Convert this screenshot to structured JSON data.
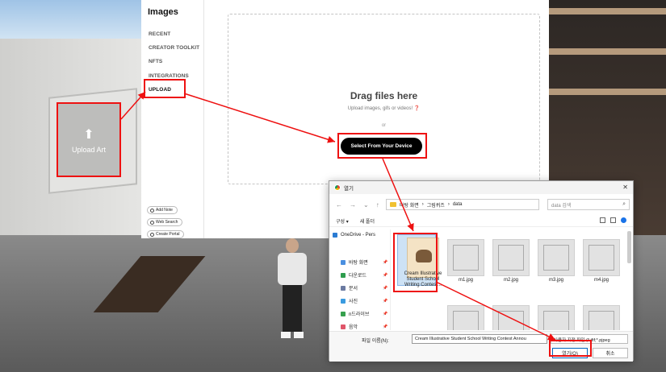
{
  "sidebar": {
    "title": "Images",
    "items": [
      {
        "label": "RECENT"
      },
      {
        "label": "CREATOR TOOLKIT"
      },
      {
        "label": "NFTS"
      },
      {
        "label": "INTEGRATIONS"
      },
      {
        "label": "UPLOAD"
      }
    ],
    "buttons": [
      {
        "label": "Add Note"
      },
      {
        "label": "Web Search"
      },
      {
        "label": "Create Portal"
      }
    ]
  },
  "scene": {
    "upload_art_label": "Upload Art",
    "upload_art_icon": "upload-arrow-icon"
  },
  "dropzone": {
    "title": "Drag files here",
    "subtitle": "Upload images, gifs or videos! ❓",
    "or_text": "or",
    "select_button": "Select From Your Device"
  },
  "dialog": {
    "title": "열기",
    "breadcrumb": [
      "바탕 화면",
      "그림퀴즈",
      "data"
    ],
    "search_placeholder": "data 검색",
    "toolbar": {
      "organize": "구성 ▾",
      "new_folder": "새 폴더"
    },
    "tree": [
      {
        "label": "OneDrive - Pers",
        "color": "#2b7cd3"
      },
      {
        "label": "바탕 화면",
        "color": "#4a8fe0"
      },
      {
        "label": "다운로드",
        "color": "#2e9d4e"
      },
      {
        "label": "문서",
        "color": "#6b7aa1"
      },
      {
        "label": "사진",
        "color": "#3a9be0"
      },
      {
        "label": "n드라이브",
        "color": "#36a04e"
      },
      {
        "label": "음악",
        "color": "#e0566a"
      }
    ],
    "selected_file": "Cream Illustrative Student School Writing Contest...",
    "files": [
      "m1.jpg",
      "m2.jpg",
      "m3.jpg",
      "m4.jpg"
    ],
    "filename_label": "파일 이름(N):",
    "filename_value": "Cream Illustrative Student School Writing Contest Annou",
    "filetype_value": "사용자 지정 파일 (*.jfif;*.pjpeg",
    "open_button": "열기(O)",
    "cancel_button": "취소"
  },
  "colors": {
    "annotation_red": "#e11111",
    "accent_black": "#000000"
  }
}
